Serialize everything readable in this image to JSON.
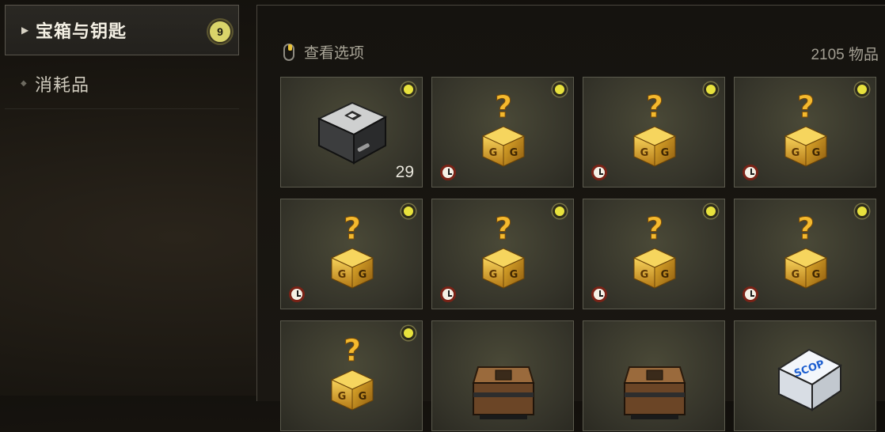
{
  "sidebar": {
    "items": [
      {
        "label": "宝箱与钥匙",
        "badge": "9",
        "active": true
      },
      {
        "label": "消耗品",
        "active": false
      }
    ]
  },
  "toolbar": {
    "view_options_label": "查看选项",
    "item_count": "2105 物品"
  },
  "inventory": {
    "items": [
      {
        "kind": "steel-crate",
        "quantity": "29",
        "new": true,
        "timed": false
      },
      {
        "kind": "mystery-box",
        "new": true,
        "timed": true
      },
      {
        "kind": "mystery-box",
        "new": true,
        "timed": true
      },
      {
        "kind": "mystery-box",
        "new": true,
        "timed": true
      },
      {
        "kind": "mystery-box",
        "new": true,
        "timed": true
      },
      {
        "kind": "mystery-box",
        "new": true,
        "timed": true
      },
      {
        "kind": "mystery-box",
        "new": true,
        "timed": true
      },
      {
        "kind": "mystery-box",
        "new": true,
        "timed": true
      },
      {
        "kind": "mystery-box",
        "new": true,
        "timed": false
      },
      {
        "kind": "bronze-chest",
        "new": false,
        "timed": false
      },
      {
        "kind": "bronze-chest",
        "new": false,
        "timed": false
      },
      {
        "kind": "scop-box",
        "label": "SCOP",
        "new": false,
        "timed": false
      }
    ]
  },
  "colors": {
    "accent": "#e8e23d",
    "timer_ring": "#7a2216",
    "gold": "#d9a72a"
  }
}
